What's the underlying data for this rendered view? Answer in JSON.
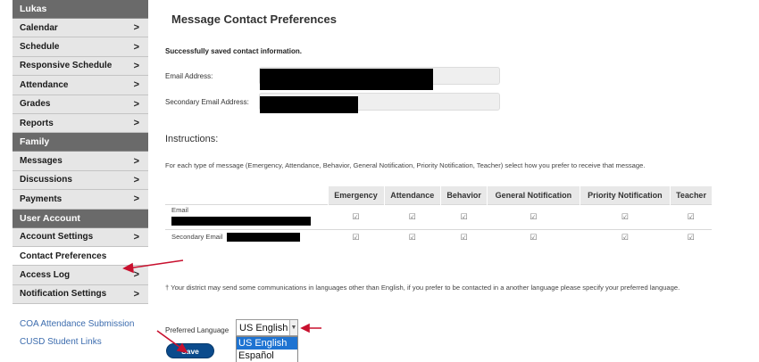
{
  "sidebar": {
    "user_name": "Lukas",
    "items_a": [
      {
        "label": "Calendar",
        "chevron": ">"
      },
      {
        "label": "Schedule",
        "chevron": ">"
      },
      {
        "label": "Responsive Schedule",
        "chevron": ">"
      },
      {
        "label": "Attendance",
        "chevron": ">"
      },
      {
        "label": "Grades",
        "chevron": ">"
      },
      {
        "label": "Reports",
        "chevron": ">"
      }
    ],
    "family_header": "Family",
    "items_b": [
      {
        "label": "Messages",
        "chevron": ">"
      },
      {
        "label": "Discussions",
        "chevron": ">"
      },
      {
        "label": "Payments",
        "chevron": ">"
      }
    ],
    "account_header": "User Account",
    "items_c": [
      {
        "label": "Account Settings",
        "chevron": ">"
      },
      {
        "label": "Contact Preferences",
        "chevron": ""
      },
      {
        "label": "Access Log",
        "chevron": ">"
      },
      {
        "label": "Notification Settings",
        "chevron": ">"
      }
    ],
    "links": [
      "COA Attendance Submission",
      "CUSD Student Links"
    ]
  },
  "main": {
    "title": "Message Contact Preferences",
    "saved_message": "Successfully saved contact information.",
    "email_label": "Email Address:",
    "secondary_email_label": "Secondary Email Address:",
    "instructions_heading": "Instructions:",
    "instructions_text": "For each type of message (Emergency, Attendance, Behavior, General Notification, Priority Notification, Teacher) select how you prefer to receive that message.",
    "table": {
      "columns": [
        "Emergency",
        "Attendance",
        "Behavior",
        "General Notification",
        "Priority Notification",
        "Teacher"
      ],
      "rows": [
        {
          "label": "Email",
          "checks": [
            "☑",
            "☑",
            "☑",
            "☑",
            "☑",
            "☑"
          ]
        },
        {
          "label": "Secondary Email",
          "checks": [
            "☑",
            "☑",
            "☑",
            "☑",
            "☑",
            "☑"
          ]
        }
      ]
    },
    "language_note": "† Your district may send some communications in languages other than English, if you prefer to be contacted in a another language please specify your preferred language.",
    "preferred_language_label": "Preferred Language",
    "preferred_language_value": "US English",
    "language_options": [
      "US English",
      "Español"
    ],
    "save_label": "Save"
  },
  "colors": {
    "sidebar_header": "#6a6a6a",
    "sidebar_item": "#e6e6e6",
    "link": "#3c6cae",
    "save_button": "#0b4b8c",
    "option_highlight": "#1e73d2",
    "annotation_arrow": "#c8102e"
  },
  "icons": {
    "chevron": "chevron-right-icon",
    "checkbox": "checked-checkbox-icon",
    "dropdown": "dropdown-arrow-icon"
  }
}
